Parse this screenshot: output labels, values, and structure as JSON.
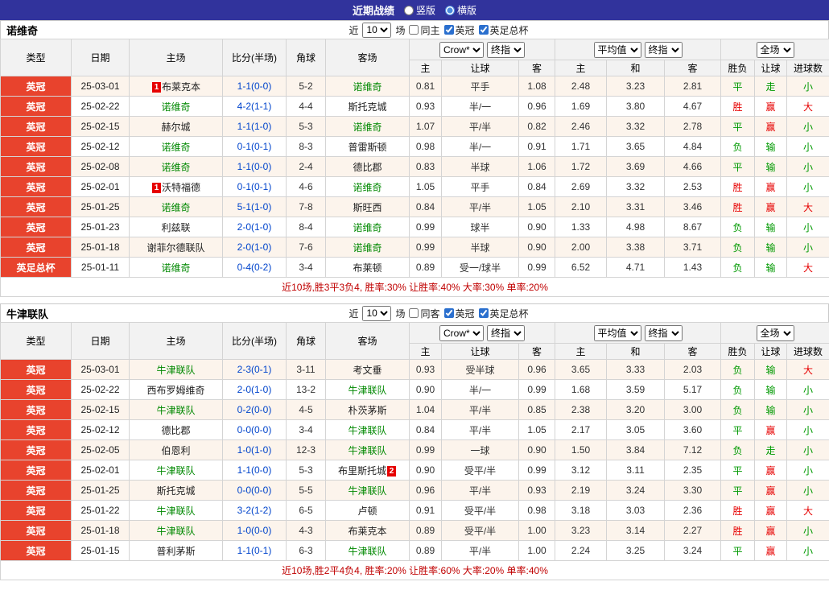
{
  "top_bar": {
    "title": "近期战绩",
    "layout_options": [
      {
        "label": "竖版",
        "selected": false
      },
      {
        "label": "横版",
        "selected": true
      }
    ]
  },
  "filter_labels": {
    "recent": "近",
    "count": "10",
    "games": "场"
  },
  "table_head": {
    "cols": [
      "类型",
      "日期",
      "主场",
      "比分(半场)",
      "角球",
      "客场"
    ],
    "asia_group": {
      "select1": "Crow*",
      "select2": "终指",
      "subcols": [
        "主",
        "让球",
        "客"
      ]
    },
    "euro_group": {
      "select1": "平均值",
      "select2": "终指",
      "subcols": [
        "主",
        "和",
        "客"
      ]
    },
    "result_group": {
      "select1": "全场",
      "subcols": [
        "胜负",
        "让球",
        "进球数"
      ]
    }
  },
  "colors": {
    "topbar_bg": "#31339c",
    "league_badge_bg": "#e8432d",
    "focus_team": "#008800",
    "win_red": "#e60000",
    "lose_green": "#009900",
    "summary_red": "#c00000",
    "score_blue": "#0044cc"
  },
  "sections": [
    {
      "team": "诺维奇",
      "filters": {
        "same": {
          "label": "同主",
          "checked": false
        },
        "league1": {
          "label": "英冠",
          "checked": true
        },
        "league2": {
          "label": "英足总杯",
          "checked": true
        }
      },
      "rows": [
        {
          "type": "英冠",
          "date": "25-03-01",
          "home": {
            "name": "布莱克本",
            "focus": false,
            "badge": "1",
            "badge_pos": "before"
          },
          "score": "1-1(0-0)",
          "corner": "5-2",
          "away": {
            "name": "诺维奇",
            "focus": true
          },
          "asia": [
            "0.81",
            "平手",
            "1.08"
          ],
          "euro": [
            "2.48",
            "3.23",
            "2.81"
          ],
          "result": {
            "text": "平",
            "color": "green"
          },
          "handicap": {
            "text": "走",
            "color": "green"
          },
          "goals": {
            "text": "小",
            "color": "green"
          }
        },
        {
          "type": "英冠",
          "date": "25-02-22",
          "home": {
            "name": "诺维奇",
            "focus": true
          },
          "score": "4-2(1-1)",
          "corner": "4-4",
          "away": {
            "name": "斯托克城",
            "focus": false
          },
          "asia": [
            "0.93",
            "半/一",
            "0.96"
          ],
          "euro": [
            "1.69",
            "3.80",
            "4.67"
          ],
          "result": {
            "text": "胜",
            "color": "red"
          },
          "handicap": {
            "text": "赢",
            "color": "red"
          },
          "goals": {
            "text": "大",
            "color": "red"
          }
        },
        {
          "type": "英冠",
          "date": "25-02-15",
          "home": {
            "name": "赫尔城",
            "focus": false
          },
          "score": "1-1(1-0)",
          "corner": "5-3",
          "away": {
            "name": "诺维奇",
            "focus": true
          },
          "asia": [
            "1.07",
            "平/半",
            "0.82"
          ],
          "euro": [
            "2.46",
            "3.32",
            "2.78"
          ],
          "result": {
            "text": "平",
            "color": "green"
          },
          "handicap": {
            "text": "赢",
            "color": "red"
          },
          "goals": {
            "text": "小",
            "color": "green"
          }
        },
        {
          "type": "英冠",
          "date": "25-02-12",
          "home": {
            "name": "诺维奇",
            "focus": true
          },
          "score": "0-1(0-1)",
          "corner": "8-3",
          "away": {
            "name": "普雷斯顿",
            "focus": false
          },
          "asia": [
            "0.98",
            "半/一",
            "0.91"
          ],
          "euro": [
            "1.71",
            "3.65",
            "4.84"
          ],
          "result": {
            "text": "负",
            "color": "green"
          },
          "handicap": {
            "text": "输",
            "color": "green"
          },
          "goals": {
            "text": "小",
            "color": "green"
          }
        },
        {
          "type": "英冠",
          "date": "25-02-08",
          "home": {
            "name": "诺维奇",
            "focus": true
          },
          "score": "1-1(0-0)",
          "corner": "2-4",
          "away": {
            "name": "德比郡",
            "focus": false
          },
          "asia": [
            "0.83",
            "半球",
            "1.06"
          ],
          "euro": [
            "1.72",
            "3.69",
            "4.66"
          ],
          "result": {
            "text": "平",
            "color": "green"
          },
          "handicap": {
            "text": "输",
            "color": "green"
          },
          "goals": {
            "text": "小",
            "color": "green"
          }
        },
        {
          "type": "英冠",
          "date": "25-02-01",
          "home": {
            "name": "沃特福德",
            "focus": false,
            "badge": "1",
            "badge_pos": "before"
          },
          "score": "0-1(0-1)",
          "corner": "4-6",
          "away": {
            "name": "诺维奇",
            "focus": true
          },
          "asia": [
            "1.05",
            "平手",
            "0.84"
          ],
          "euro": [
            "2.69",
            "3.32",
            "2.53"
          ],
          "result": {
            "text": "胜",
            "color": "red"
          },
          "handicap": {
            "text": "赢",
            "color": "red"
          },
          "goals": {
            "text": "小",
            "color": "green"
          }
        },
        {
          "type": "英冠",
          "date": "25-01-25",
          "home": {
            "name": "诺维奇",
            "focus": true
          },
          "score": "5-1(1-0)",
          "corner": "7-8",
          "away": {
            "name": "斯旺西",
            "focus": false
          },
          "asia": [
            "0.84",
            "平/半",
            "1.05"
          ],
          "euro": [
            "2.10",
            "3.31",
            "3.46"
          ],
          "result": {
            "text": "胜",
            "color": "red"
          },
          "handicap": {
            "text": "赢",
            "color": "red"
          },
          "goals": {
            "text": "大",
            "color": "red"
          }
        },
        {
          "type": "英冠",
          "date": "25-01-23",
          "home": {
            "name": "利兹联",
            "focus": false
          },
          "score": "2-0(1-0)",
          "corner": "8-4",
          "away": {
            "name": "诺维奇",
            "focus": true
          },
          "asia": [
            "0.99",
            "球半",
            "0.90"
          ],
          "euro": [
            "1.33",
            "4.98",
            "8.67"
          ],
          "result": {
            "text": "负",
            "color": "green"
          },
          "handicap": {
            "text": "输",
            "color": "green"
          },
          "goals": {
            "text": "小",
            "color": "green"
          }
        },
        {
          "type": "英冠",
          "date": "25-01-18",
          "home": {
            "name": "谢菲尔德联队",
            "focus": false
          },
          "score": "2-0(1-0)",
          "corner": "7-6",
          "away": {
            "name": "诺维奇",
            "focus": true
          },
          "asia": [
            "0.99",
            "半球",
            "0.90"
          ],
          "euro": [
            "2.00",
            "3.38",
            "3.71"
          ],
          "result": {
            "text": "负",
            "color": "green"
          },
          "handicap": {
            "text": "输",
            "color": "green"
          },
          "goals": {
            "text": "小",
            "color": "green"
          }
        },
        {
          "type": "英足总杯",
          "date": "25-01-11",
          "home": {
            "name": "诺维奇",
            "focus": true
          },
          "score": "0-4(0-2)",
          "corner": "3-4",
          "away": {
            "name": "布莱顿",
            "focus": false
          },
          "asia": [
            "0.89",
            "受一/球半",
            "0.99"
          ],
          "euro": [
            "6.52",
            "4.71",
            "1.43"
          ],
          "result": {
            "text": "负",
            "color": "green"
          },
          "handicap": {
            "text": "输",
            "color": "green"
          },
          "goals": {
            "text": "大",
            "color": "red"
          }
        }
      ],
      "summary": "近10场,胜3平3负4, 胜率:30% 让胜率:40% 大率:30% 单率:20%"
    },
    {
      "team": "牛津联队",
      "filters": {
        "same": {
          "label": "同客",
          "checked": false
        },
        "league1": {
          "label": "英冠",
          "checked": true
        },
        "league2": {
          "label": "英足总杯",
          "checked": true
        }
      },
      "rows": [
        {
          "type": "英冠",
          "date": "25-03-01",
          "home": {
            "name": "牛津联队",
            "focus": true
          },
          "score": "2-3(0-1)",
          "corner": "3-11",
          "away": {
            "name": "考文垂",
            "focus": false
          },
          "asia": [
            "0.93",
            "受半球",
            "0.96"
          ],
          "euro": [
            "3.65",
            "3.33",
            "2.03"
          ],
          "result": {
            "text": "负",
            "color": "green"
          },
          "handicap": {
            "text": "输",
            "color": "green"
          },
          "goals": {
            "text": "大",
            "color": "red"
          }
        },
        {
          "type": "英冠",
          "date": "25-02-22",
          "home": {
            "name": "西布罗姆维奇",
            "focus": false
          },
          "score": "2-0(1-0)",
          "corner": "13-2",
          "away": {
            "name": "牛津联队",
            "focus": true
          },
          "asia": [
            "0.90",
            "半/一",
            "0.99"
          ],
          "euro": [
            "1.68",
            "3.59",
            "5.17"
          ],
          "result": {
            "text": "负",
            "color": "green"
          },
          "handicap": {
            "text": "输",
            "color": "green"
          },
          "goals": {
            "text": "小",
            "color": "green"
          }
        },
        {
          "type": "英冠",
          "date": "25-02-15",
          "home": {
            "name": "牛津联队",
            "focus": true
          },
          "score": "0-2(0-0)",
          "corner": "4-5",
          "away": {
            "name": "朴茨茅斯",
            "focus": false
          },
          "asia": [
            "1.04",
            "平/半",
            "0.85"
          ],
          "euro": [
            "2.38",
            "3.20",
            "3.00"
          ],
          "result": {
            "text": "负",
            "color": "green"
          },
          "handicap": {
            "text": "输",
            "color": "green"
          },
          "goals": {
            "text": "小",
            "color": "green"
          }
        },
        {
          "type": "英冠",
          "date": "25-02-12",
          "home": {
            "name": "德比郡",
            "focus": false
          },
          "score": "0-0(0-0)",
          "corner": "3-4",
          "away": {
            "name": "牛津联队",
            "focus": true
          },
          "asia": [
            "0.84",
            "平/半",
            "1.05"
          ],
          "euro": [
            "2.17",
            "3.05",
            "3.60"
          ],
          "result": {
            "text": "平",
            "color": "green"
          },
          "handicap": {
            "text": "赢",
            "color": "red"
          },
          "goals": {
            "text": "小",
            "color": "green"
          }
        },
        {
          "type": "英冠",
          "date": "25-02-05",
          "home": {
            "name": "伯恩利",
            "focus": false
          },
          "score": "1-0(1-0)",
          "corner": "12-3",
          "away": {
            "name": "牛津联队",
            "focus": true
          },
          "asia": [
            "0.99",
            "一球",
            "0.90"
          ],
          "euro": [
            "1.50",
            "3.84",
            "7.12"
          ],
          "result": {
            "text": "负",
            "color": "green"
          },
          "handicap": {
            "text": "走",
            "color": "green"
          },
          "goals": {
            "text": "小",
            "color": "green"
          }
        },
        {
          "type": "英冠",
          "date": "25-02-01",
          "home": {
            "name": "牛津联队",
            "focus": true
          },
          "score": "1-1(0-0)",
          "corner": "5-3",
          "away": {
            "name": "布里斯托城",
            "focus": false,
            "badge": "2",
            "badge_pos": "after"
          },
          "asia": [
            "0.90",
            "受平/半",
            "0.99"
          ],
          "euro": [
            "3.12",
            "3.11",
            "2.35"
          ],
          "result": {
            "text": "平",
            "color": "green"
          },
          "handicap": {
            "text": "赢",
            "color": "red"
          },
          "goals": {
            "text": "小",
            "color": "green"
          }
        },
        {
          "type": "英冠",
          "date": "25-01-25",
          "home": {
            "name": "斯托克城",
            "focus": false
          },
          "score": "0-0(0-0)",
          "corner": "5-5",
          "away": {
            "name": "牛津联队",
            "focus": true
          },
          "asia": [
            "0.96",
            "平/半",
            "0.93"
          ],
          "euro": [
            "2.19",
            "3.24",
            "3.30"
          ],
          "result": {
            "text": "平",
            "color": "green"
          },
          "handicap": {
            "text": "赢",
            "color": "red"
          },
          "goals": {
            "text": "小",
            "color": "green"
          }
        },
        {
          "type": "英冠",
          "date": "25-01-22",
          "home": {
            "name": "牛津联队",
            "focus": true
          },
          "score": "3-2(1-2)",
          "corner": "6-5",
          "away": {
            "name": "卢顿",
            "focus": false
          },
          "asia": [
            "0.91",
            "受平/半",
            "0.98"
          ],
          "euro": [
            "3.18",
            "3.03",
            "2.36"
          ],
          "result": {
            "text": "胜",
            "color": "red"
          },
          "handicap": {
            "text": "赢",
            "color": "red"
          },
          "goals": {
            "text": "大",
            "color": "red"
          }
        },
        {
          "type": "英冠",
          "date": "25-01-18",
          "home": {
            "name": "牛津联队",
            "focus": true
          },
          "score": "1-0(0-0)",
          "corner": "4-3",
          "away": {
            "name": "布莱克本",
            "focus": false
          },
          "asia": [
            "0.89",
            "受平/半",
            "1.00"
          ],
          "euro": [
            "3.23",
            "3.14",
            "2.27"
          ],
          "result": {
            "text": "胜",
            "color": "red"
          },
          "handicap": {
            "text": "赢",
            "color": "red"
          },
          "goals": {
            "text": "小",
            "color": "green"
          }
        },
        {
          "type": "英冠",
          "date": "25-01-15",
          "home": {
            "name": "普利茅斯",
            "focus": false
          },
          "score": "1-1(0-1)",
          "corner": "6-3",
          "away": {
            "name": "牛津联队",
            "focus": true
          },
          "asia": [
            "0.89",
            "平/半",
            "1.00"
          ],
          "euro": [
            "2.24",
            "3.25",
            "3.24"
          ],
          "result": {
            "text": "平",
            "color": "green"
          },
          "handicap": {
            "text": "赢",
            "color": "red"
          },
          "goals": {
            "text": "小",
            "color": "green"
          }
        }
      ],
      "summary": "近10场,胜2平4负4, 胜率:20% 让胜率:60% 大率:20% 单率:40%"
    }
  ]
}
